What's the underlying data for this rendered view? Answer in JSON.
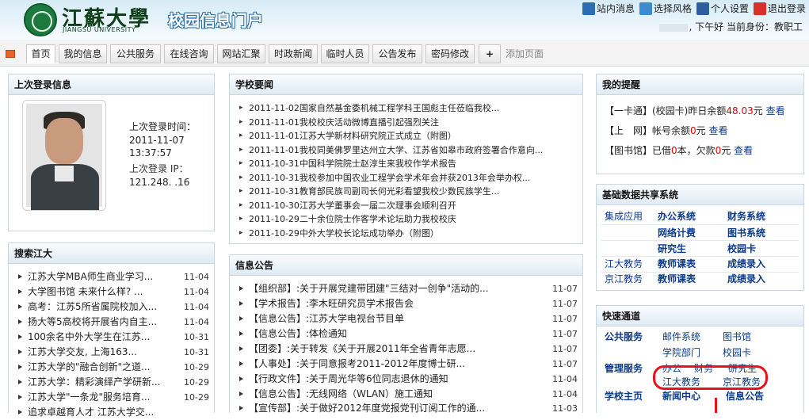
{
  "header": {
    "uni_name": "江蘇大學",
    "uni_name_en": "JIANGSU UNIVERSITY",
    "portal_title": "校园信息门户",
    "top_links": [
      {
        "label": "站内消息",
        "icon": "message-icon",
        "color": "#2a6db5"
      },
      {
        "label": "选择风格",
        "icon": "style-icon",
        "color": "#3c8ad0"
      },
      {
        "label": "个人设置",
        "icon": "user-settings-icon",
        "color": "#2c5e9e"
      },
      {
        "label": "退出登录",
        "icon": "logout-icon",
        "color": "#d9302a"
      }
    ],
    "greeting": ", 下午好  当前身份：教职工"
  },
  "tabs": [
    {
      "label": "首页",
      "active": true
    },
    {
      "label": "我的信息"
    },
    {
      "label": "公共服务"
    },
    {
      "label": "在线咨询"
    },
    {
      "label": "网站汇聚"
    },
    {
      "label": "时政新闻"
    },
    {
      "label": "临时人员"
    },
    {
      "label": "公告发布"
    },
    {
      "label": "密码修改"
    },
    {
      "label": "+"
    }
  ],
  "add_page": "添加页面",
  "last_login": {
    "title": "上次登录信息",
    "time_label": "上次登录时间：",
    "date": "2011-11-07",
    "time": "13:37:57",
    "ip_label": "上次登录 IP：",
    "ip": "121.248.   .16"
  },
  "school_news": {
    "title": "学校要闻",
    "items": [
      "2011-11-02国家自然基金委机械工程学科王国彪主任莅临我校...",
      "2011-11-01我校校庆活动微博直播引起强烈关注",
      "2011-11-01江苏大学新材料研究院正式成立（附图）",
      "2011-11-01我校同美佛罗里达州立大学、江苏省如皋市政府签署合作意向...",
      "2011-10-31中国科学院院士赵淳生来我校作学术报告",
      "2011-10-31我校参加中国农业工程学会学术年会并获2013年会举办权...",
      "2011-10-31教育部民族司副司长何光彩看望我校少数民族学生...",
      "2011-10-30江苏大学董事会一届二次理事会顺利召开",
      "2011-10-29二十余位院士作客学术论坛助力我校校庆",
      "2011-10-29中外大学校长论坛成功举办（附图）"
    ]
  },
  "reminders": {
    "title": "我的提醒",
    "card": {
      "prefix": "【一卡通】(校园卡)昨日余额",
      "amount": "48.03",
      "unit": "元",
      "link": "查看"
    },
    "net": {
      "prefix": "【上　网】帐号余额",
      "amount": "0",
      "unit": "元",
      "link": "查看"
    },
    "library": {
      "prefix": "【图书馆】已借",
      "borrowed": "0",
      "mid": "本，欠款",
      "owed": "0",
      "unit": "元",
      "link": "查看"
    }
  },
  "basic_data": {
    "title": "基础数据共享系统",
    "rows": [
      {
        "cat": "集成应用",
        "a": "办公系统",
        "b": "财务系统"
      },
      {
        "cat": "",
        "a": "网络计费",
        "b": "图书系统"
      },
      {
        "cat": "",
        "a": "研究生",
        "b": "校园卡"
      },
      {
        "cat": "江大教务",
        "a": "教师课表",
        "b": "成绩录入"
      },
      {
        "cat": "京江教务",
        "a": "教师课表",
        "b": "成绩录入"
      }
    ]
  },
  "search": {
    "title": "搜索江大",
    "items": [
      {
        "text": "江苏大学MBA师生商业学习...",
        "date": "11-04"
      },
      {
        "text": "大学图书馆 未来什么样? ...",
        "date": "11-04"
      },
      {
        "text": "高考：江苏5所省属院校加入...",
        "date": "11-04"
      },
      {
        "text": "扬大等5高校将开展省内自主...",
        "date": "11-04"
      },
      {
        "text": "100余名中外大学生在江苏...",
        "date": "10-31"
      },
      {
        "text": "江苏大学交友, 上海163...",
        "date": "10-31"
      },
      {
        "text": "江苏大学的\"融合创新\"之道...",
        "date": "10-29"
      },
      {
        "text": "江苏大学：精彩演绎产学研新...",
        "date": "10-29"
      },
      {
        "text": "江苏大学\"一条龙\"服务培育...",
        "date": "10-29"
      },
      {
        "text": "追求卓越育人才 江苏大学交...",
        "date": ""
      }
    ]
  },
  "notices": {
    "title": "信息公告",
    "items": [
      {
        "text": "【组织部】:关于开展党建带团建\"三结对一创争\"活动的...",
        "date": "11-07"
      },
      {
        "text": "【学术报告】:李木旺研究员学术报告会",
        "date": "11-07"
      },
      {
        "text": "【信息公告】:江苏大学电视台节目单",
        "date": "11-07"
      },
      {
        "text": "【信息公告】:体检通知",
        "date": "11-07"
      },
      {
        "text": "【团委】:关于转发《关于开展2011年全省青年志愿...",
        "date": "11-07"
      },
      {
        "text": "【人事处】:关于同意报考2011-2012年度博士研...",
        "date": "11-07"
      },
      {
        "text": "【行政文件】:关于周光华等6位同志退休的通知",
        "date": "11-04"
      },
      {
        "text": "【信息公告】:无线网络（WLAN）施工通知",
        "date": "11-04"
      },
      {
        "text": "【宣传部】:关于做好2012年度党报党刊订阅工作的通...",
        "date": "11-03"
      }
    ]
  },
  "quick": {
    "title": "快速通道",
    "public_label": "公共服务",
    "public": [
      "邮件系统",
      "图书馆",
      "学院部门",
      "校园卡"
    ],
    "manage_label": "管理服务",
    "manage": [
      "办公",
      "财务",
      "研究生",
      "江大教务",
      "京江教务"
    ],
    "bottom": [
      "学校主页",
      "新闻中心",
      "信息公告"
    ]
  }
}
